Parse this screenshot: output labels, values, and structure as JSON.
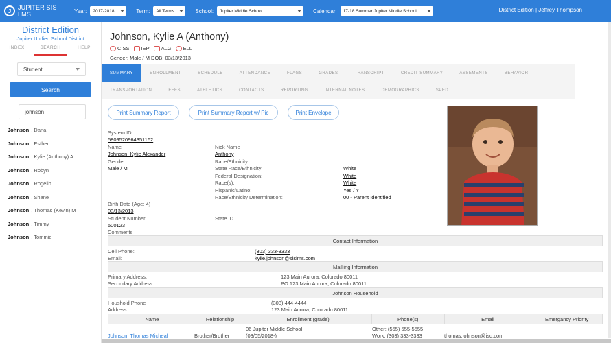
{
  "app": {
    "name": "JUPITER SIS LMS",
    "logo_letter": "J"
  },
  "filters": {
    "year_label": "Year:",
    "year_value": "2017-2018",
    "term_label": "Term:",
    "term_value": "All Terms",
    "school_label": "School:",
    "school_value": "Jupiter Middle School",
    "calendar_label": "Calendar:",
    "calendar_value": "17-18 Summer Jupiter Middle School"
  },
  "header_user": "District Edition | Jeffrey Thompson",
  "sidebar": {
    "title": "District Edition",
    "district": "Jupiter Unified School District",
    "tabs": [
      "INDEX",
      "SEARCH",
      "HELP"
    ],
    "type_value": "Student",
    "search_button": "Search",
    "query": "johnson",
    "results": [
      {
        "last": "Johnson",
        "first": ", Dana"
      },
      {
        "last": "Johnson",
        "first": ", Esther"
      },
      {
        "last": "Johnson",
        "first": ", Kylie (Anthony) A"
      },
      {
        "last": "Johnson",
        "first": ", Robyn"
      },
      {
        "last": "Johnson",
        "first": ", Rogelio"
      },
      {
        "last": "Johnson",
        "first": ", Shane"
      },
      {
        "last": "Johnson",
        "first": ", Thomas (Kevin) M"
      },
      {
        "last": "Johnson",
        "first": ", Timmy"
      },
      {
        "last": "Johnson",
        "first": ", Tommie"
      }
    ]
  },
  "student": {
    "name": "Johnson, Kylie A (Anthony)",
    "flags": [
      "CISS",
      "IEP",
      "ALG",
      "ELL"
    ],
    "gender_dob": "Gender: Male / M DOB: 03/13/2013"
  },
  "tabs_row1": [
    "SUMMARY",
    "ENROLLMENT",
    "SCHEDULE",
    "ATTENDANCE",
    "FLAGS",
    "GRADES",
    "TRANSCRIPT",
    "CREDIT SUMMARY",
    "ASSEMENTS",
    "BEHAVIOR"
  ],
  "tabs_row2": [
    "TRANSPORTATION",
    "FEES",
    "ATHLETICS",
    "CONTACTS",
    "REPORTING",
    "INTERNAL NOTES",
    "DEMOGRAPHICS",
    "SPED"
  ],
  "actions": [
    "Print Summary Report",
    "Print Summary Report w/ Pic",
    "Print Envelope"
  ],
  "fields": {
    "system_id_label": "System ID:",
    "system_id": "5809520964351162",
    "name_label": "Name",
    "name": "Johnson, Kylie Alexander",
    "gender_label": "Gender",
    "gender": "Male / M",
    "nick_label": "Nick Name",
    "nick": "Anthony",
    "race_label": "Race/Ethnicity",
    "state_race_label": "State Race/Ethnicity:",
    "state_race": "White",
    "federal_label": "Federal Designation:",
    "federal": "White",
    "races_label": "Race(s):",
    "races": "White",
    "hispanic_label": "Hispanic/Latino:",
    "hispanic": "Yes / Y",
    "determination_label": "Race/Ethnicity Determination:",
    "determination": "00 - Parent Identified",
    "birth_label": "Birth Date (Age: 4)",
    "birth": "03/13/2013",
    "student_number_label": "Student Number",
    "student_number": "500123",
    "state_id_label": "State ID",
    "comments_label": "Comments"
  },
  "contact": {
    "section": "Contact Information",
    "cell_label": "Cell Phone:",
    "cell": "(303) 333-3333",
    "email_label": "Email:",
    "email": "kylie.johnson@sislms.com"
  },
  "mailing": {
    "section": "Mailling Information",
    "primary_label": "Primary Address:",
    "primary": "123 Main Aurora, Colorado 80011",
    "secondary_label": "Secondary Address:",
    "secondary": "PO 123 Main Aurora, Colorado 80011"
  },
  "household": {
    "section": "Johnson Household",
    "phone_label": "Houshold Phone",
    "phone": "(303) 444-4444",
    "address_label": "Address",
    "address": "123 Main Aurora, Colorado 80011"
  },
  "guardians": {
    "headers": [
      "Name",
      "Relationship",
      "Enrollment (grade)",
      "Phone(s)",
      "Email",
      "Emergancy Priority"
    ],
    "row": {
      "name": "Johnson, Thomas Micheal",
      "relationship": "Brother/Brother",
      "enrollment_1": "06 Jupiter Middle School",
      "enrollment_2": "(03/05/2018-)",
      "phone_1": "Other: (555) 555-5555",
      "phone_2": "Work: (303) 333-3333",
      "email": "thomas.johnson@isd.com"
    }
  }
}
